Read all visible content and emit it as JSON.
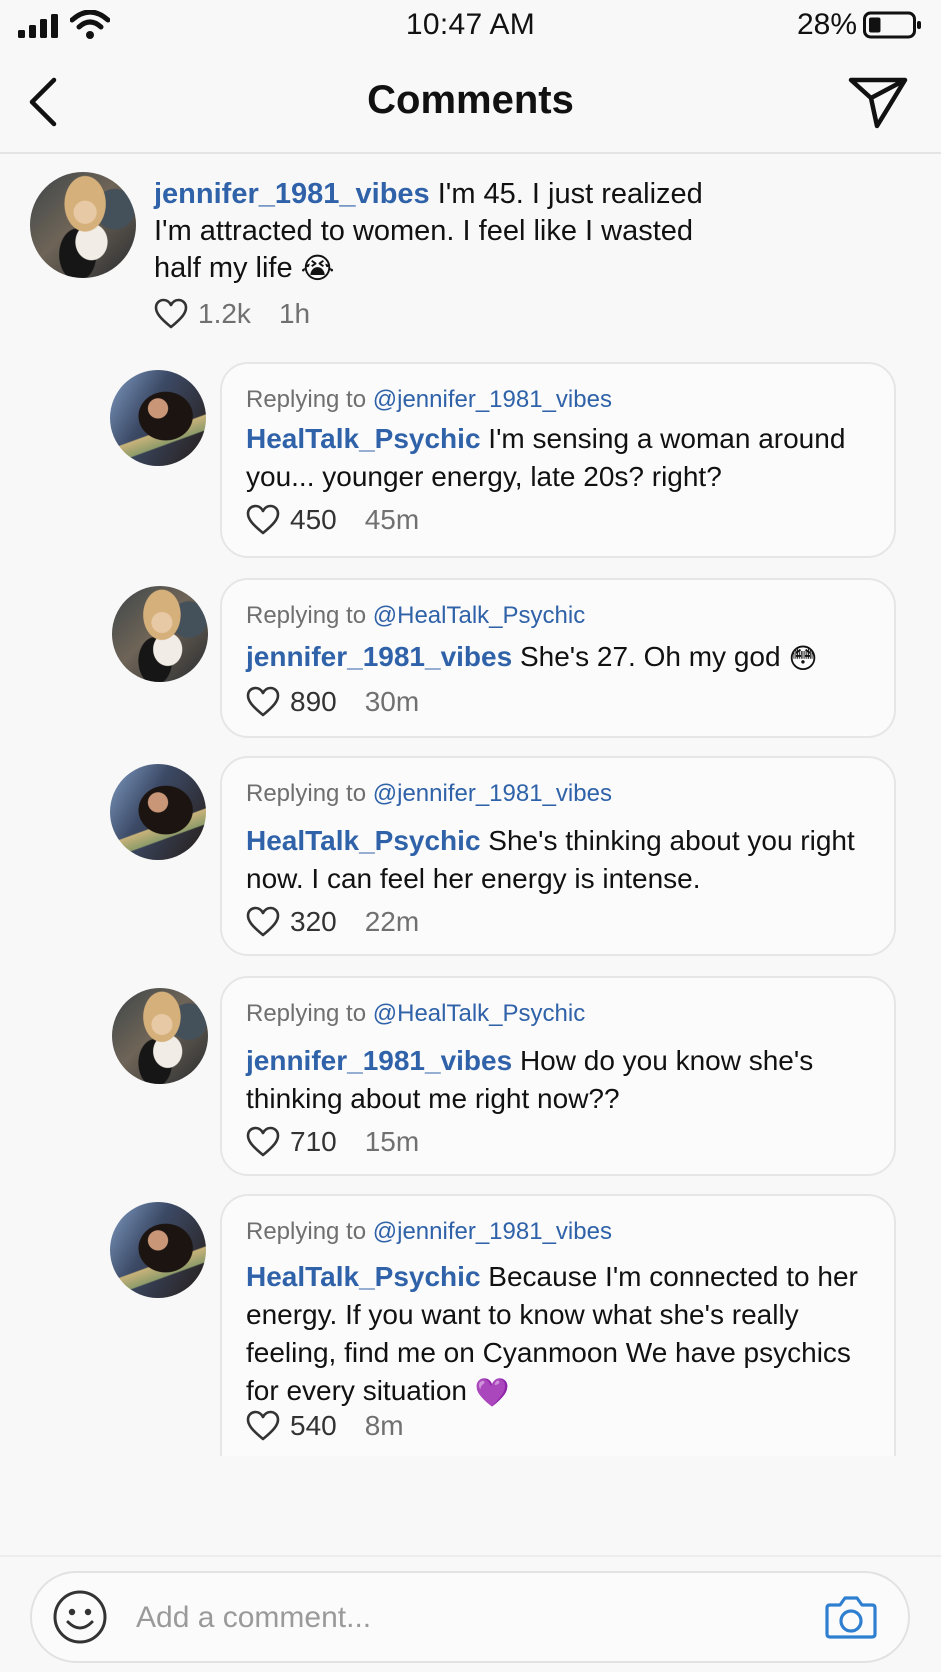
{
  "status_bar": {
    "time": "10:47 AM",
    "battery_percent": "28%",
    "battery_level": 0.28,
    "signal_icon": "signal-bars-icon",
    "wifi_icon": "wifi-icon",
    "battery_icon": "battery-icon"
  },
  "header": {
    "title": "Comments",
    "back_icon": "chevron-left-icon",
    "send_icon": "paper-plane-icon"
  },
  "main_comment": {
    "username": "jennifer_1981_vibes",
    "text": " I'm 45. I just realized I'm attracted to women. I feel like I wasted half my life ",
    "emoji": "😭",
    "likes": "1.2k",
    "time": "1h"
  },
  "replies": [
    {
      "replying_prefix": "Replying to ",
      "replying_to": "@jennifer_1981_vibes",
      "username": "HealTalk_Psychic",
      "text": " I'm sensing a woman around you... younger energy, late 20s? right?",
      "emoji": "",
      "likes": "450",
      "time": "45m"
    },
    {
      "replying_prefix": "Replying to ",
      "replying_to": "@HealTalk_Psychic",
      "username": "jennifer_1981_vibes",
      "text": " She's 27. Oh my god ",
      "emoji": "😳",
      "likes": "890",
      "time": "30m"
    },
    {
      "replying_prefix": "Replying to ",
      "replying_to": "@jennifer_1981_vibes",
      "username": "HealTalk_Psychic",
      "text": " She's thinking about you right now. I can feel her energy is intense.",
      "emoji": "",
      "likes": "320",
      "time": "22m"
    },
    {
      "replying_prefix": "Replying to ",
      "replying_to": "@HealTalk_Psychic",
      "username": "jennifer_1981_vibes",
      "text": " How do you know she's thinking about me right now??",
      "emoji": "",
      "likes": "710",
      "time": "15m"
    },
    {
      "replying_prefix": "Replying to ",
      "replying_to": "@jennifer_1981_vibes",
      "username": "HealTalk_Psychic",
      "text": " Because I'm connected to her energy. If you want to know what she's really feeling, find me on Cyanmoon We have psychics for every situation ",
      "emoji": "💜",
      "likes": "540",
      "time": "8m"
    }
  ],
  "composer": {
    "placeholder": "Add a comment...",
    "emoji_icon": "smiley-face-icon",
    "camera_icon": "camera-icon"
  },
  "colors": {
    "link": "#2f62a8",
    "background": "#f8f8f8",
    "meta_text": "#707070"
  }
}
